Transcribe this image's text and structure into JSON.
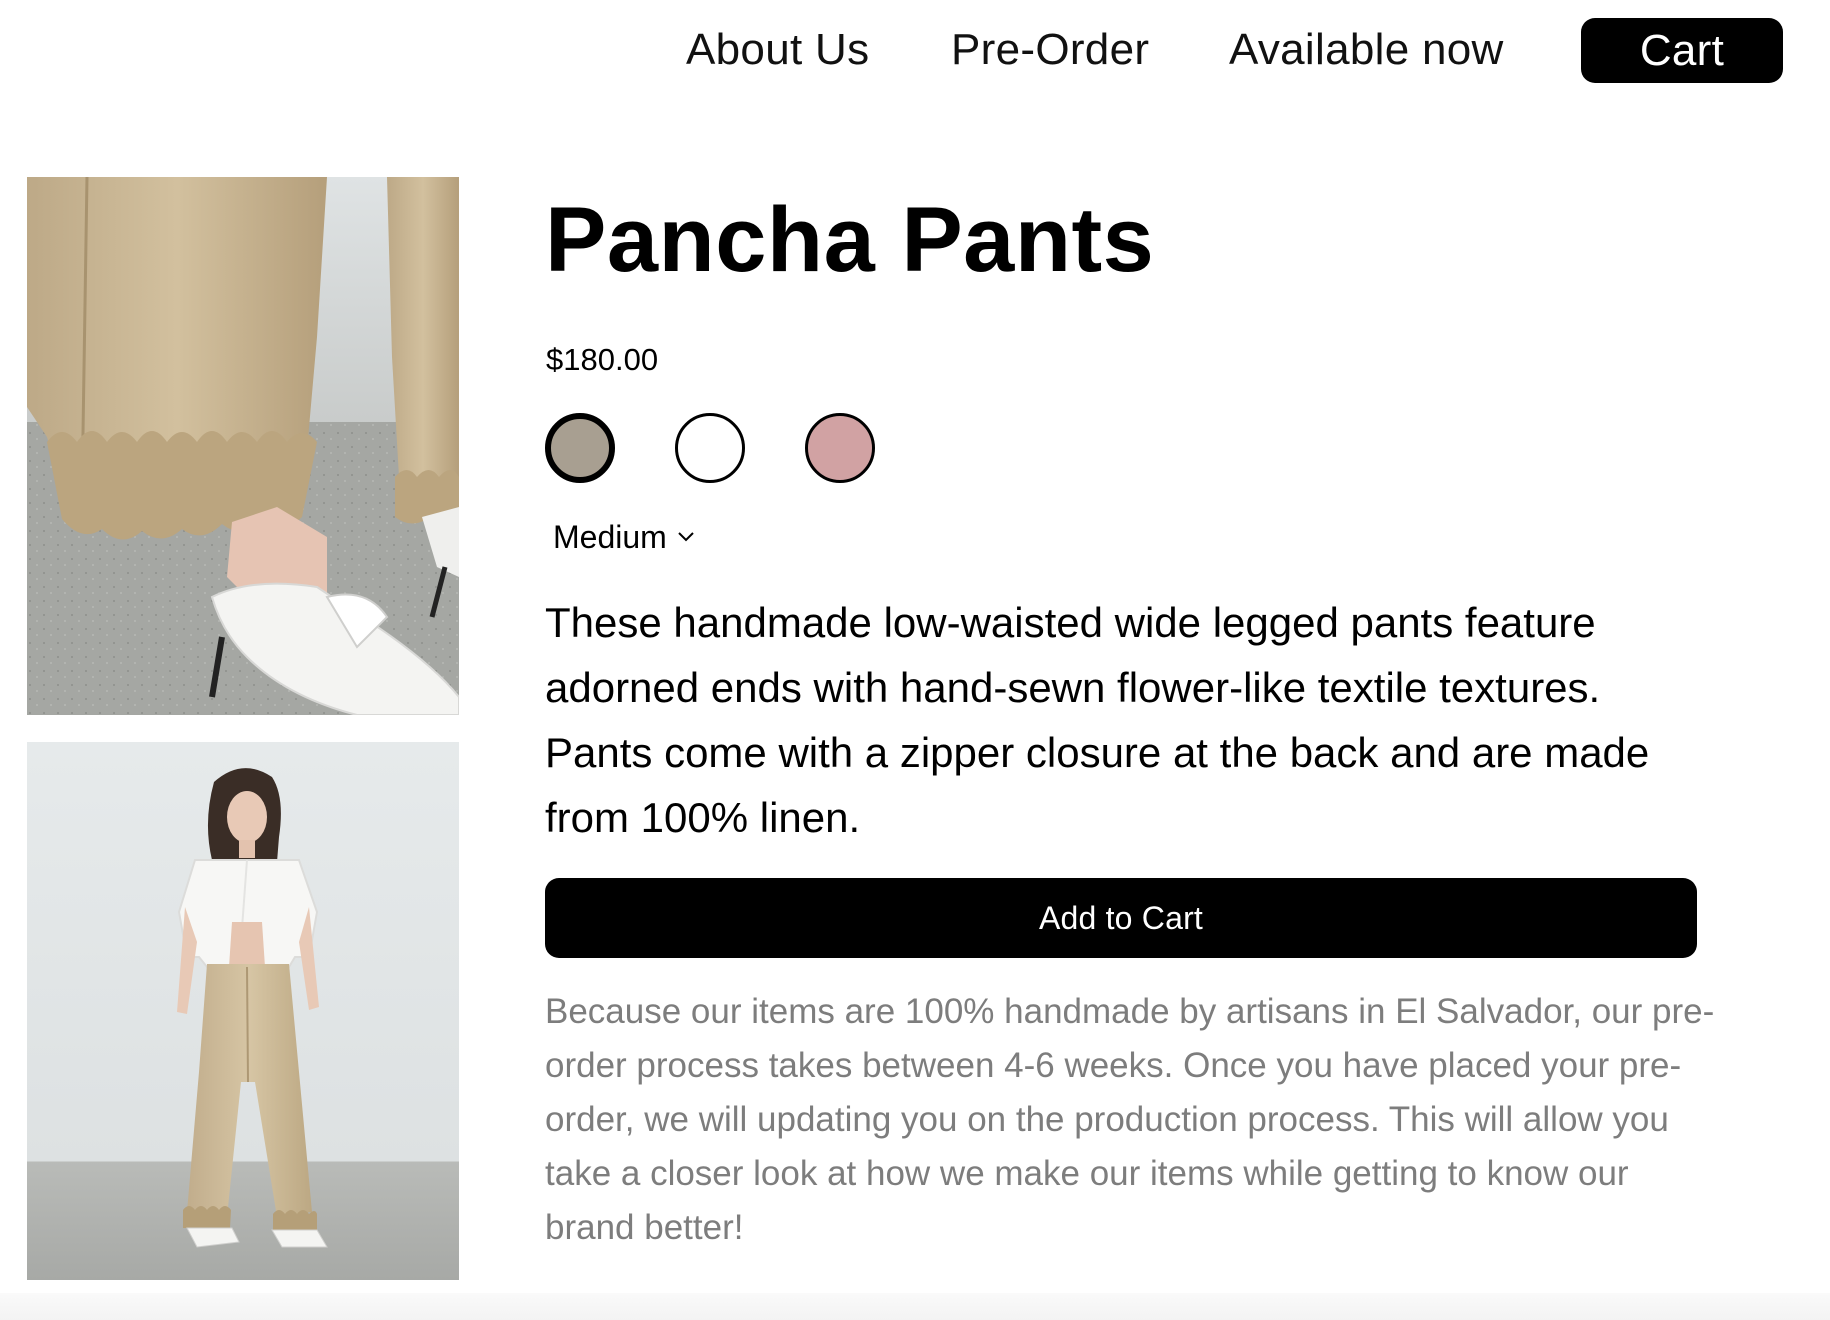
{
  "nav": {
    "links": [
      "About Us",
      "Pre-Order",
      "Available now"
    ],
    "cart_label": "Cart"
  },
  "gallery": [
    {
      "icon": "pants-hem-detail-photo"
    },
    {
      "icon": "model-full-body-photo"
    }
  ],
  "product": {
    "title": "Pancha Pants",
    "price": "$180.00",
    "swatches": [
      {
        "color": "#a89f91",
        "selected": true
      },
      {
        "color": "#ffffff",
        "selected": false
      },
      {
        "color": "#d1a2a3",
        "selected": false
      }
    ],
    "size": "Medium",
    "description": "These handmade low-waisted wide legged pants feature adorned ends with hand-sewn flower-like textile textures. Pants come with a zipper closure at the back and are made from 100% linen.",
    "add_to_cart_label": "Add to Cart",
    "note": "Because our items are 100% handmade by artisans in El Salvador, our pre-order process takes between 4-6 weeks. Once you have placed your pre-order, we will updating you on the production process. This will allow you take a closer look at how we make our items while getting to know our brand better!"
  },
  "colors": {
    "accent": "#000000",
    "muted_text": "#7d7d7d"
  }
}
